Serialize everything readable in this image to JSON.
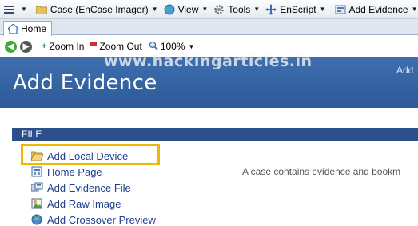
{
  "menubar": {
    "case_label": "Case (EnCase Imager)",
    "view_label": "View",
    "tools_label": "Tools",
    "enscript_label": "EnScript",
    "add_evidence_label": "Add Evidence"
  },
  "tabs": {
    "home_label": "Home"
  },
  "toolbar": {
    "zoom_in_label": "Zoom In",
    "zoom_out_label": "Zoom Out",
    "zoom_level": "100%"
  },
  "banner": {
    "title": "Add Evidence",
    "right_text": "Add",
    "watermark": "www.hackingarticles.in"
  },
  "section": {
    "title": "FILE"
  },
  "actions": [
    {
      "label": "Add Local Device",
      "icon": "folder-open-icon"
    },
    {
      "label": "Home Page",
      "icon": "home-page-icon"
    },
    {
      "label": "Add Evidence File",
      "icon": "evidence-file-icon"
    },
    {
      "label": "Add Raw Image",
      "icon": "raw-image-icon"
    },
    {
      "label": "Add Crossover Preview",
      "icon": "crossover-icon"
    }
  ],
  "description": "A case contains evidence and bookm",
  "colors": {
    "banner": "#3a69aa",
    "section_header": "#2b4f8b",
    "link": "#1f3f8f",
    "highlight": "#f2b800"
  }
}
